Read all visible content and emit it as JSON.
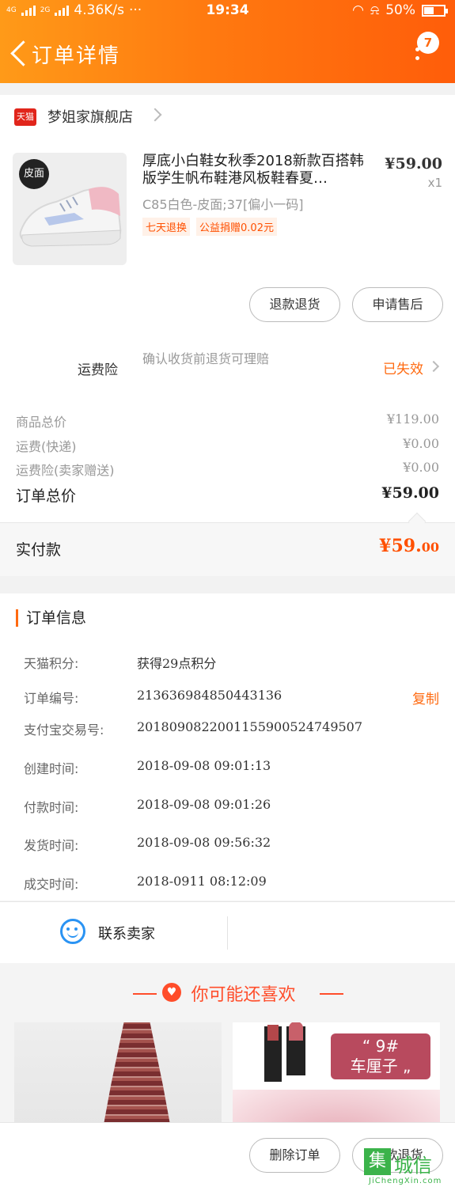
{
  "status_bar": {
    "network": "4G",
    "network2": "2G",
    "speed": "4.36K/s",
    "dots": "···",
    "time": "19:34",
    "battery": "50%"
  },
  "header": {
    "title": "订单详情",
    "badge": "7"
  },
  "shop": {
    "platform": "天猫",
    "name": "梦姐家旗舰店"
  },
  "product": {
    "image_tag": "皮面",
    "title": "厚底小白鞋女秋季2018新款百搭韩版学生帆布鞋港风板鞋春夏…",
    "price": "¥59.00",
    "qty": "x1",
    "sku": "C85白色-皮面;37[偏小一码]",
    "tags": [
      "七天退换",
      "公益捐赠0.02元"
    ]
  },
  "actions": {
    "refund": "退款退货",
    "aftersale": "申请售后"
  },
  "insurance": {
    "label": "运费险",
    "desc": "确认收货前退货可理赔",
    "status": "已失效"
  },
  "fees": {
    "goods_label": "商品总价",
    "goods_value": "¥119.00",
    "ship_label": "运费(快递)",
    "ship_value": "¥0.00",
    "ins_label": "运费险(卖家赠送)",
    "ins_value": "¥0.00",
    "total_label": "订单总价",
    "total_value": "¥59.00"
  },
  "payment": {
    "label": "实付款",
    "amount_main": "¥59.",
    "amount_cents": "00"
  },
  "order_info": {
    "title": "订单信息",
    "rows": [
      {
        "k": "天猫积分:",
        "v": "获得29点积分"
      },
      {
        "k": "订单编号:",
        "v": "213636984850443136"
      },
      {
        "k": "支付宝交易号:",
        "v": "2018090822001155900524749507"
      },
      {
        "k": "创建时间:",
        "v": "2018-09-08 09:01:13"
      },
      {
        "k": "付款时间:",
        "v": "2018-09-08 09:01:26"
      },
      {
        "k": "发货时间:",
        "v": "2018-09-08 09:56:32"
      },
      {
        "k": "成交时间:",
        "v": "2018-0911 08:12:09"
      }
    ],
    "copy": "复制"
  },
  "contact": {
    "label": "联系卖家"
  },
  "recommend": {
    "title": "你可能还喜欢",
    "item_b_number": "“ 9#",
    "item_b_text": "车厘子 „"
  },
  "bottom_bar": {
    "delete": "删除订单",
    "refund": "退款退货"
  },
  "watermark": {
    "box": "集",
    "text": "城信",
    "sub": "JiChengXin.com"
  },
  "colors": {
    "accent": "#ff6a10",
    "price_red": "#ff5000",
    "contact_blue": "#2a93f3"
  }
}
